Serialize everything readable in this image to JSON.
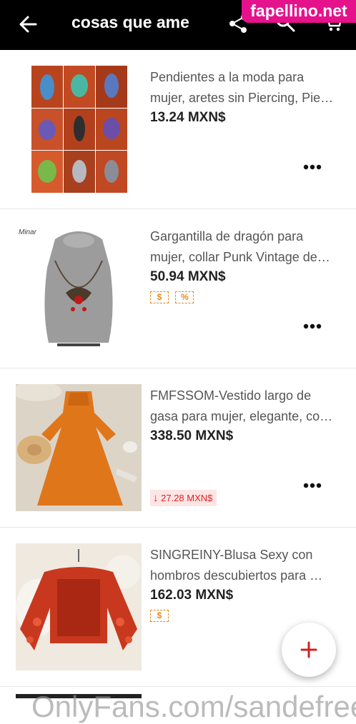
{
  "header": {
    "title": "cosas que ame"
  },
  "watermark": "fapellino.net",
  "bottom_watermark": "OnlyFans.com/sandefree",
  "items": [
    {
      "name_line1": "Pendientes a la moda para",
      "name_line2": "mujer, aretes sin Piercing, Pie…",
      "price": "13.24 MXN$"
    },
    {
      "name_line1": "Gargantilla de dragón para",
      "name_line2": "mujer, collar Punk Vintage de…",
      "price": "50.94 MXN$",
      "brand": "Minar",
      "badge1": "$",
      "badge2": "%"
    },
    {
      "name_line1": "FMFSSOM-Vestido largo de",
      "name_line2": "gasa para mujer, elegante, co…",
      "price": "338.50 MXN$",
      "price_drop": "27.28 MXN$"
    },
    {
      "name_line1": "SINGREINY-Blusa Sexy con",
      "name_line2": "hombros descubiertos para …",
      "price": "162.03 MXN$",
      "badge1": "$"
    }
  ],
  "colors": {
    "topbar": "#000000",
    "accent_red": "#d42020",
    "badge_orange": "#e88a1a"
  },
  "icons": [
    "back-arrow-icon",
    "share-icon",
    "search-icon",
    "cart-icon",
    "more-dots-icon",
    "plus-icon"
  ]
}
